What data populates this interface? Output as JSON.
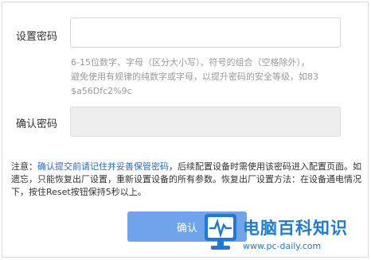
{
  "form": {
    "password_label": "设置密码",
    "password_value": "",
    "hint_line1": "6-15位数字、字母（区分大小写）、符号的组合（空格除外），",
    "hint_line2": "避免使用有规律的纯数字或字母，以提升密码的安全等级，如83",
    "hint_line3": "$a56Dfc2%9c",
    "confirm_label": "确认密码",
    "confirm_value": ""
  },
  "notice": {
    "prefix": "注意：",
    "link_text": "确认提交前请记住并妥善保管密码",
    "rest": "，后续配置设备时需使用该密码进入配置页面。如遗忘，只能恢复出厂设置，重新设置设备的所有参数。恢复出厂设置方法：在设备通电情况下，按住Reset按钮保持5秒以上。"
  },
  "confirm_button": {
    "label": "确认"
  },
  "watermark": {
    "title": "电脑百科知识",
    "url": "www.pc-daily.com",
    "icon": "monitor-pulse-icon",
    "color": "#1d7ad6"
  }
}
